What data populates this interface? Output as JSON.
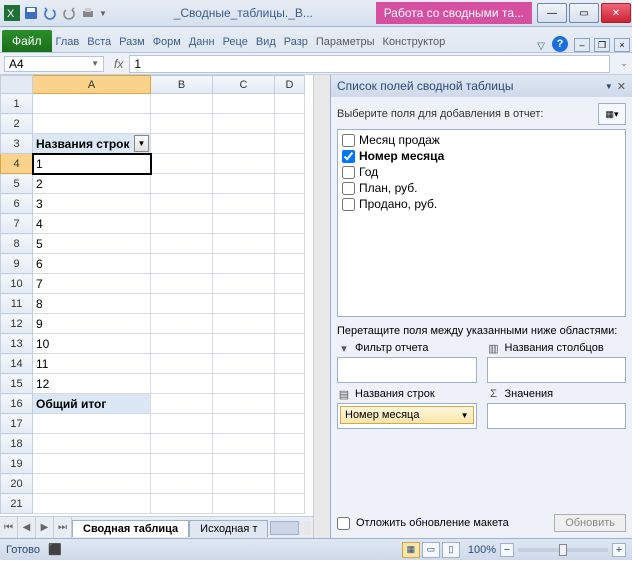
{
  "title": "_Сводные_таблицы._В...",
  "pivot_tools_label": "Работа со сводными та...",
  "ribbon": {
    "file": "Файл",
    "tabs": [
      "Глав",
      "Вста",
      "Разм",
      "Форм",
      "Данн",
      "Реце",
      "Вид",
      "Разр"
    ],
    "ctx_tabs": [
      "Параметры",
      "Конструктор"
    ]
  },
  "namebox": "A4",
  "formula": "1",
  "columns": [
    "A",
    "B",
    "C",
    "D"
  ],
  "rows": [
    1,
    2,
    3,
    4,
    5,
    6,
    7,
    8,
    9,
    10,
    11,
    12,
    13,
    14,
    15,
    16,
    17,
    18,
    19,
    20,
    21
  ],
  "cells": {
    "r3A": "Названия строк",
    "r4A": "1",
    "r5A": "2",
    "r6A": "3",
    "r7A": "4",
    "r8A": "5",
    "r9A": "6",
    "r10A": "7",
    "r11A": "8",
    "r12A": "9",
    "r13A": "10",
    "r14A": "11",
    "r15A": "12",
    "r16A": "Общий итог"
  },
  "sheet_tabs": {
    "active": "Сводная таблица",
    "other": "Исходная т"
  },
  "pane": {
    "title": "Список полей сводной таблицы",
    "choose_label": "Выберите поля для добавления в отчет:",
    "fields": [
      {
        "label": "Месяц продаж",
        "checked": false
      },
      {
        "label": "Номер месяца",
        "checked": true
      },
      {
        "label": "Год",
        "checked": false
      },
      {
        "label": "План, руб.",
        "checked": false
      },
      {
        "label": "Продано, руб.",
        "checked": false
      }
    ],
    "drag_label": "Перетащите поля между указанными ниже областями:",
    "area_filter": "Фильтр отчета",
    "area_cols": "Названия столбцов",
    "area_rows": "Названия строк",
    "area_vals": "Значения",
    "row_chip": "Номер месяца",
    "defer": "Отложить обновление макета",
    "update": "Обновить"
  },
  "status": {
    "ready": "Готово",
    "zoom": "100%"
  }
}
